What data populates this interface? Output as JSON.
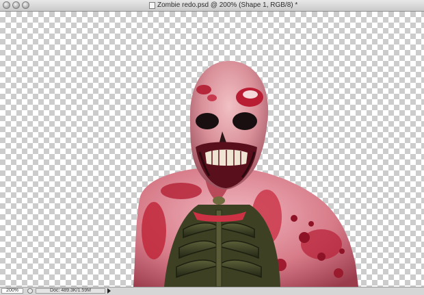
{
  "window": {
    "title": "Zombie redo.psd @ 200% (Shape 1, RGB/8) *",
    "buttons": [
      "close",
      "minimize",
      "zoom"
    ]
  },
  "canvas": {
    "layer_content": "zombie figure on transparent background",
    "icon": "zombie-artwork"
  },
  "statusbar": {
    "zoom_value": "200%",
    "doc_info": "Doc: 489.3K/1.59M"
  },
  "colors": {
    "checker_light": "#ffffff",
    "checker_dark": "#cccccc",
    "flesh_red": "#c22a3a",
    "skull_pink": "#e7a3a9"
  }
}
